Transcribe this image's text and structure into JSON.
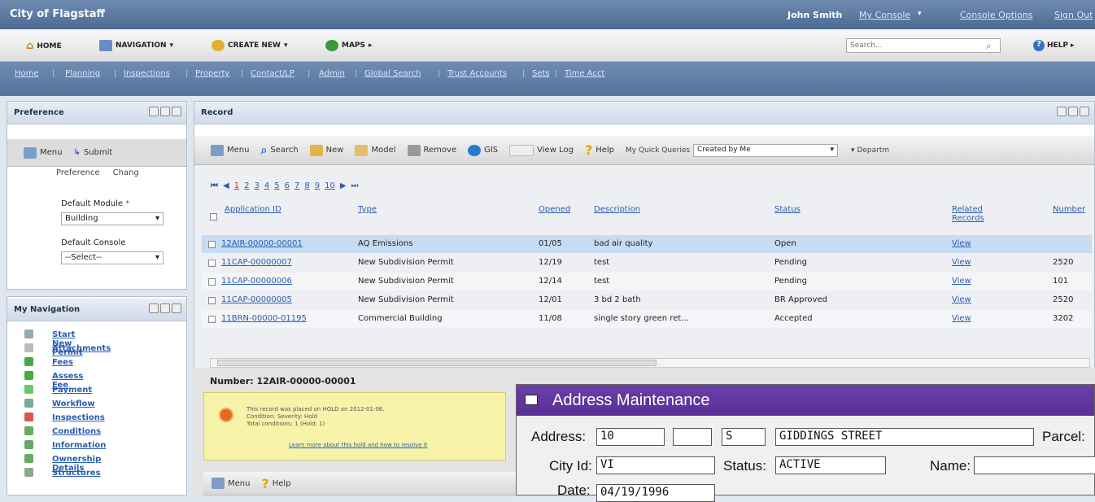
{
  "topbar": {
    "title": "City of Flagstaff",
    "user": "John Smith",
    "my_console": "My Console",
    "console_options": "Console Options",
    "sign_out": "Sign Out"
  },
  "toolbar": {
    "home": "HOME",
    "navigation": "NAVIGATION",
    "create_new": "CREATE NEW",
    "maps": "MAPS",
    "search_placeholder": "Search...",
    "help": "HELP"
  },
  "navbar": {
    "links": [
      "Home",
      "Planning",
      "Inspections",
      "Property",
      "Contact/LP",
      "Admin",
      "Global Search",
      "Trust Accounts",
      "Sets",
      "Time Acct"
    ]
  },
  "preference": {
    "title": "Preference",
    "menu": "Menu",
    "submit": "Submit",
    "tab_preference": "Preference",
    "tab_change": "Chang",
    "default_module_label": "Default Module",
    "default_module_value": "Building",
    "default_console_label": "Default Console",
    "default_console_value": "--Select--"
  },
  "record": {
    "title": "Record",
    "menu_items": [
      "Menu",
      "Search",
      "New",
      "Model",
      "Remove",
      "GIS",
      "View Log",
      "Help"
    ],
    "quick_queries_label": "My Quick Queries",
    "quick_queries_value": "Created by Me",
    "department": "Departm",
    "pages": [
      "1",
      "2",
      "3",
      "4",
      "5",
      "6",
      "7",
      "8",
      "9",
      "10"
    ],
    "columns": [
      "Application ID",
      "Type",
      "Opened",
      "Description",
      "Status",
      "Related Records",
      "Number"
    ],
    "rows": [
      {
        "id": "12AIR-00000-00001",
        "type": "AQ Emissions",
        "opened": "01/05",
        "desc": "bad air quality",
        "status": "Open",
        "related": "View",
        "number": ""
      },
      {
        "id": "11CAP-00000007",
        "type": "New Subdivision Permit",
        "opened": "12/19",
        "desc": "test",
        "status": "Pending",
        "related": "View",
        "number": "2520"
      },
      {
        "id": "11CAP-00000006",
        "type": "New Subdivision Permit",
        "opened": "12/14",
        "desc": "test",
        "status": "Pending",
        "related": "View",
        "number": "101"
      },
      {
        "id": "11CAP-00000005",
        "type": "New Subdivision Permit",
        "opened": "12/01",
        "desc": "3 bd 2 bath",
        "status": "BR Approved",
        "related": "View",
        "number": "2520"
      },
      {
        "id": "11BRN-00000-01195",
        "type": "Commercial Building",
        "opened": "11/08",
        "desc": "single story green ret...",
        "status": "Accepted",
        "related": "View",
        "number": "3202"
      }
    ],
    "detail_number": "Number: 12AIR-00000-00001",
    "hold_line1": "This record was placed on HOLD on 2012-01-06.",
    "hold_line2": "Condition: Severity: Hold",
    "hold_line3": "Total conditions: 1  (Hold: 1)",
    "hold_link": "Learn more about this hold and how to resolve it",
    "detail_menu": "Menu",
    "detail_help": "Help"
  },
  "mynav": {
    "title": "My Navigation",
    "items": [
      "Start New Permit",
      "Attachments",
      "Fees",
      "Assess Fee",
      "Payment",
      "Workflow",
      "Inspections",
      "Conditions",
      "Information",
      "Ownership Details",
      "Structures"
    ]
  },
  "address": {
    "title": "Address Maintenance",
    "address_label": "Address:",
    "address_num": "10",
    "address_dir": "S",
    "street": "GIDDINGS STREET",
    "parcel_label": "Parcel:",
    "cityid_label": "City Id:",
    "cityid": "VI",
    "status_label": "Status:",
    "status": "ACTIVE",
    "name_label": "Name:",
    "date_label": "Date:",
    "date": "04/19/1996"
  }
}
